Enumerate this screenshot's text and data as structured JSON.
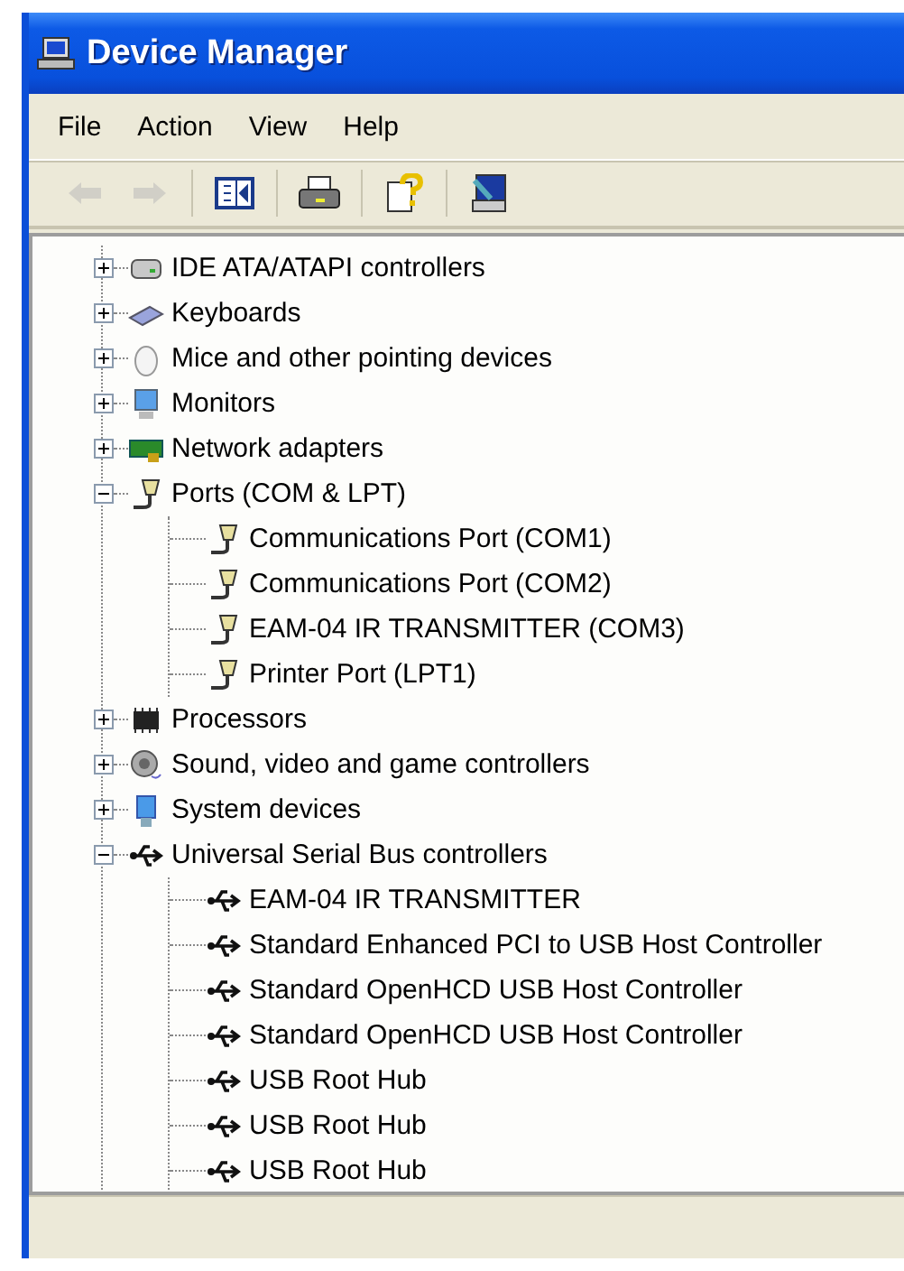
{
  "window": {
    "title": "Device Manager"
  },
  "menu": [
    "File",
    "Action",
    "View",
    "Help"
  ],
  "toolbar": [
    [
      {
        "kind": "back",
        "disabled": true
      },
      {
        "kind": "forward",
        "disabled": true
      }
    ],
    [
      {
        "kind": "tree",
        "disabled": false
      }
    ],
    [
      {
        "kind": "print",
        "disabled": false
      }
    ],
    [
      {
        "kind": "help",
        "disabled": false
      }
    ],
    [
      {
        "kind": "scan",
        "disabled": false
      }
    ]
  ],
  "tree": [
    {
      "label": "IDE ATA/ATAPI controllers",
      "kind": "drive",
      "expanded": false
    },
    {
      "label": "Keyboards",
      "kind": "keyboard",
      "expanded": false
    },
    {
      "label": "Mice and other pointing devices",
      "kind": "mouse",
      "expanded": false
    },
    {
      "label": "Monitors",
      "kind": "monitor",
      "expanded": false
    },
    {
      "label": "Network adapters",
      "kind": "network",
      "expanded": false
    },
    {
      "label": "Ports (COM & LPT)",
      "kind": "port",
      "expanded": true,
      "children": [
        {
          "label": "Communications Port (COM1)",
          "kind": "port"
        },
        {
          "label": "Communications Port (COM2)",
          "kind": "port"
        },
        {
          "label": "EAM-04 IR TRANSMITTER (COM3)",
          "kind": "port"
        },
        {
          "label": "Printer Port (LPT1)",
          "kind": "port"
        }
      ]
    },
    {
      "label": "Processors",
      "kind": "chip",
      "expanded": false
    },
    {
      "label": "Sound, video and game controllers",
      "kind": "sound",
      "expanded": false
    },
    {
      "label": "System devices",
      "kind": "system",
      "expanded": false
    },
    {
      "label": "Universal Serial Bus controllers",
      "kind": "usb",
      "expanded": true,
      "children": [
        {
          "label": "EAM-04 IR TRANSMITTER",
          "kind": "usb"
        },
        {
          "label": "Standard Enhanced PCI to USB Host Controller",
          "kind": "usb"
        },
        {
          "label": "Standard OpenHCD USB Host Controller",
          "kind": "usb"
        },
        {
          "label": "Standard OpenHCD USB Host Controller",
          "kind": "usb"
        },
        {
          "label": "USB Root Hub",
          "kind": "usb"
        },
        {
          "label": "USB Root Hub",
          "kind": "usb"
        },
        {
          "label": "USB Root Hub",
          "kind": "usb"
        }
      ]
    }
  ]
}
